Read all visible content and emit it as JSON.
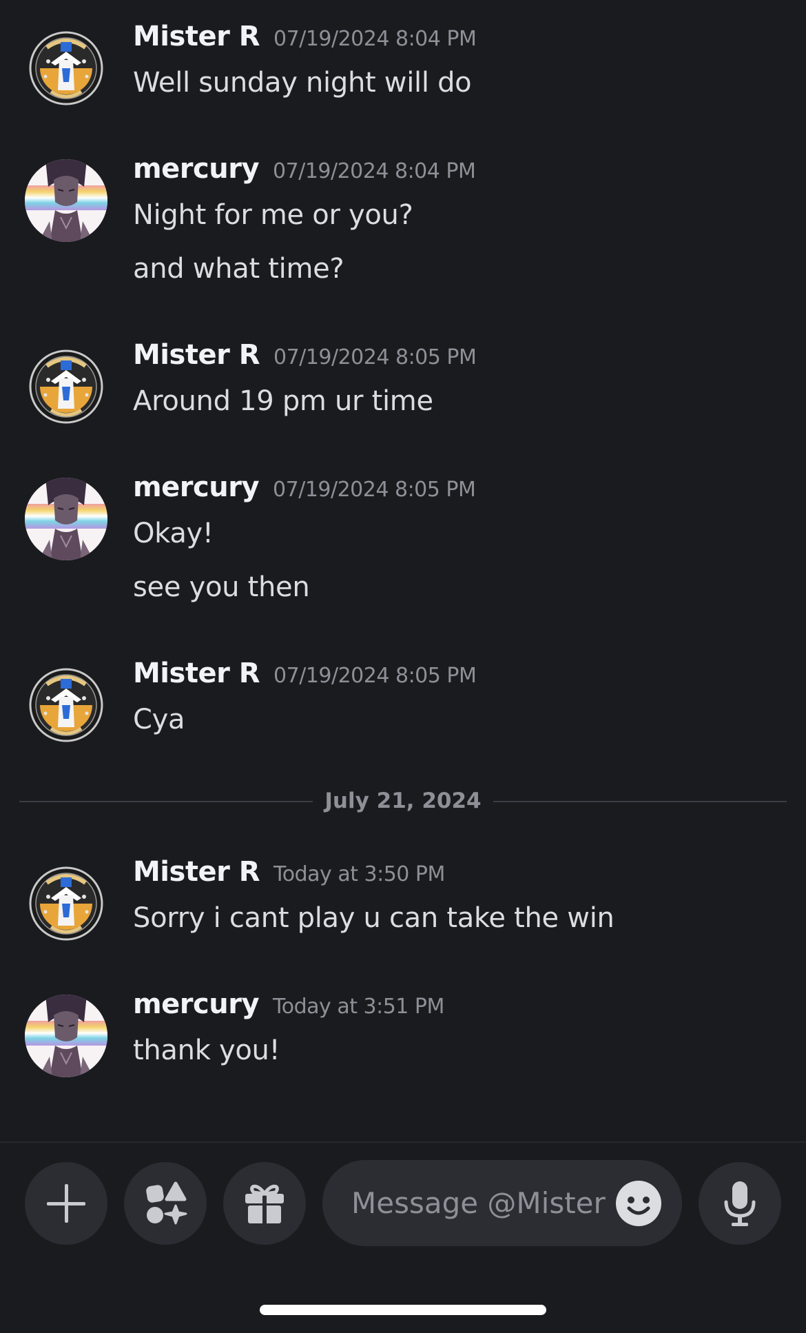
{
  "conversation": {
    "messages": [
      {
        "author": "Mister R",
        "timestamp": "07/19/2024 8:04 PM",
        "lines": [
          "Well sunday night will do"
        ]
      },
      {
        "author": "mercury",
        "timestamp": "07/19/2024 8:04 PM",
        "lines": [
          "Night for me or you?",
          "and what time?"
        ]
      },
      {
        "author": "Mister R",
        "timestamp": "07/19/2024 8:05 PM",
        "lines": [
          "Around 19 pm ur time"
        ]
      },
      {
        "author": "mercury",
        "timestamp": "07/19/2024 8:05 PM",
        "lines": [
          "Okay!",
          "see you then"
        ]
      },
      {
        "author": "Mister R",
        "timestamp": "07/19/2024 8:05 PM",
        "lines": [
          "Cya"
        ]
      },
      {
        "author": "Mister R",
        "timestamp": "Today at 3:50 PM",
        "lines": [
          "Sorry i cant play u can take the win"
        ]
      },
      {
        "author": "mercury",
        "timestamp": "Today at 3:51 PM",
        "lines": [
          "thank you!"
        ]
      }
    ],
    "date_divider": "July 21, 2024"
  },
  "composer": {
    "placeholder": "Message @Mister R",
    "buttons": {
      "add": "plus-icon",
      "apps": "apps-icon",
      "gift": "gift-icon",
      "emoji": "emoji-icon",
      "voice": "microphone-icon"
    }
  },
  "colors": {
    "background": "#1a1b1f",
    "surface": "#2b2d33",
    "text_primary": "#f2f3f5",
    "text_muted": "#8e9097"
  }
}
